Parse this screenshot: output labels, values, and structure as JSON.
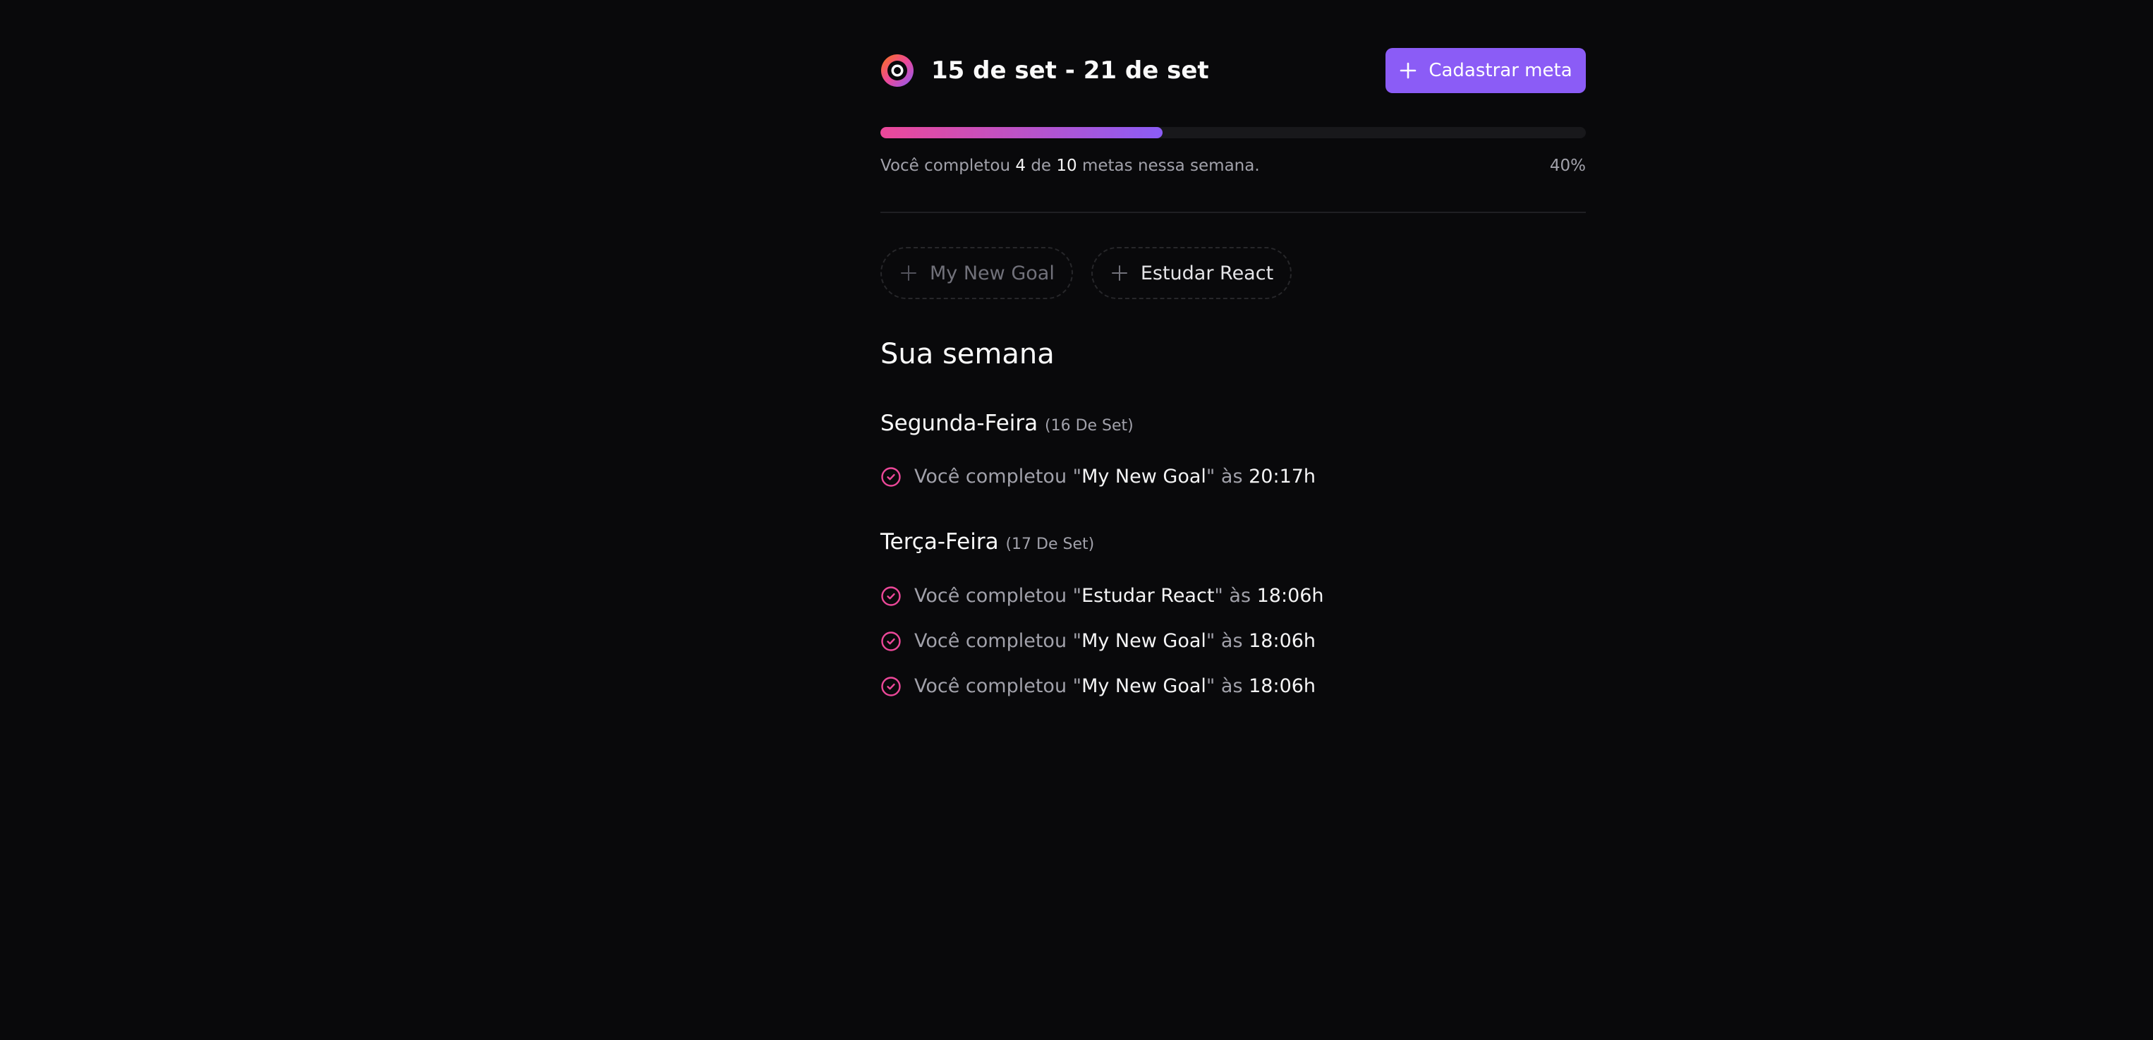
{
  "header": {
    "week_range": "15 de set - 21 de set",
    "create_goal_label": "Cadastrar meta"
  },
  "progress": {
    "prefix": "Você completou",
    "completed": "4",
    "connector": "de",
    "total": "10",
    "suffix": "metas nessa semana.",
    "percent_label": "40%",
    "fraction": 0.4
  },
  "pending_goals": [
    {
      "label": "My New Goal",
      "enabled": false
    },
    {
      "label": "Estudar React",
      "enabled": true
    }
  ],
  "summary": {
    "title": "Sua semana",
    "days": [
      {
        "weekday": "Segunda-Feira",
        "date": "(16 De Set)",
        "entries": [
          {
            "prefix": "Você completou \"",
            "goal": "My New Goal",
            "middle": "\" às ",
            "time": "20:17h"
          }
        ]
      },
      {
        "weekday": "Terça-Feira",
        "date": "(17 De Set)",
        "entries": [
          {
            "prefix": "Você completou \"",
            "goal": "Estudar React",
            "middle": "\" às ",
            "time": "18:06h"
          },
          {
            "prefix": "Você completou \"",
            "goal": "My New Goal",
            "middle": "\" às ",
            "time": "18:06h"
          },
          {
            "prefix": "Você completou \"",
            "goal": "My New Goal",
            "middle": "\" às ",
            "time": "18:06h"
          }
        ]
      }
    ]
  },
  "icons": {
    "logo": "app-logo-icon",
    "plus": "plus-icon",
    "check": "circle-check-icon"
  },
  "colors": {
    "background": "#09090b",
    "accent": "#8b5cf6",
    "accent_pink": "#ec4899",
    "muted_text": "#a1a1aa"
  }
}
